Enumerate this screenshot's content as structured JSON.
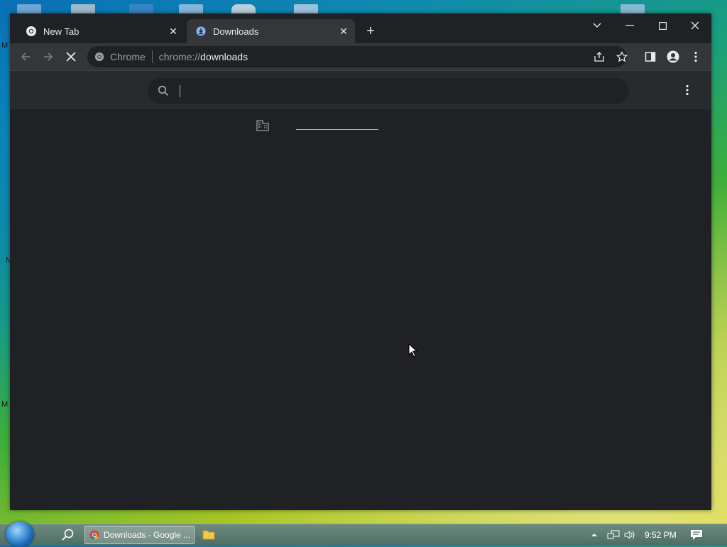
{
  "browser": {
    "tabs": [
      {
        "title": "New Tab",
        "icon": "chrome-icon",
        "active": false
      },
      {
        "title": "Downloads",
        "icon": "download-icon",
        "active": true
      }
    ],
    "omnibox": {
      "site_label": "Chrome",
      "url_scheme": "chrome://",
      "url_host": "downloads"
    }
  },
  "downloads": {
    "search": {
      "value": "",
      "placeholder": ""
    }
  },
  "taskbar": {
    "active_window_label": "Downloads - Google ...",
    "clock": "9:52 PM"
  },
  "desktop": {
    "edge_letters": [
      "M",
      "N",
      "M"
    ]
  },
  "colors": {
    "window_bg": "#202124",
    "toolbar_bg": "#35363a",
    "accent": "#8ab4f8"
  }
}
